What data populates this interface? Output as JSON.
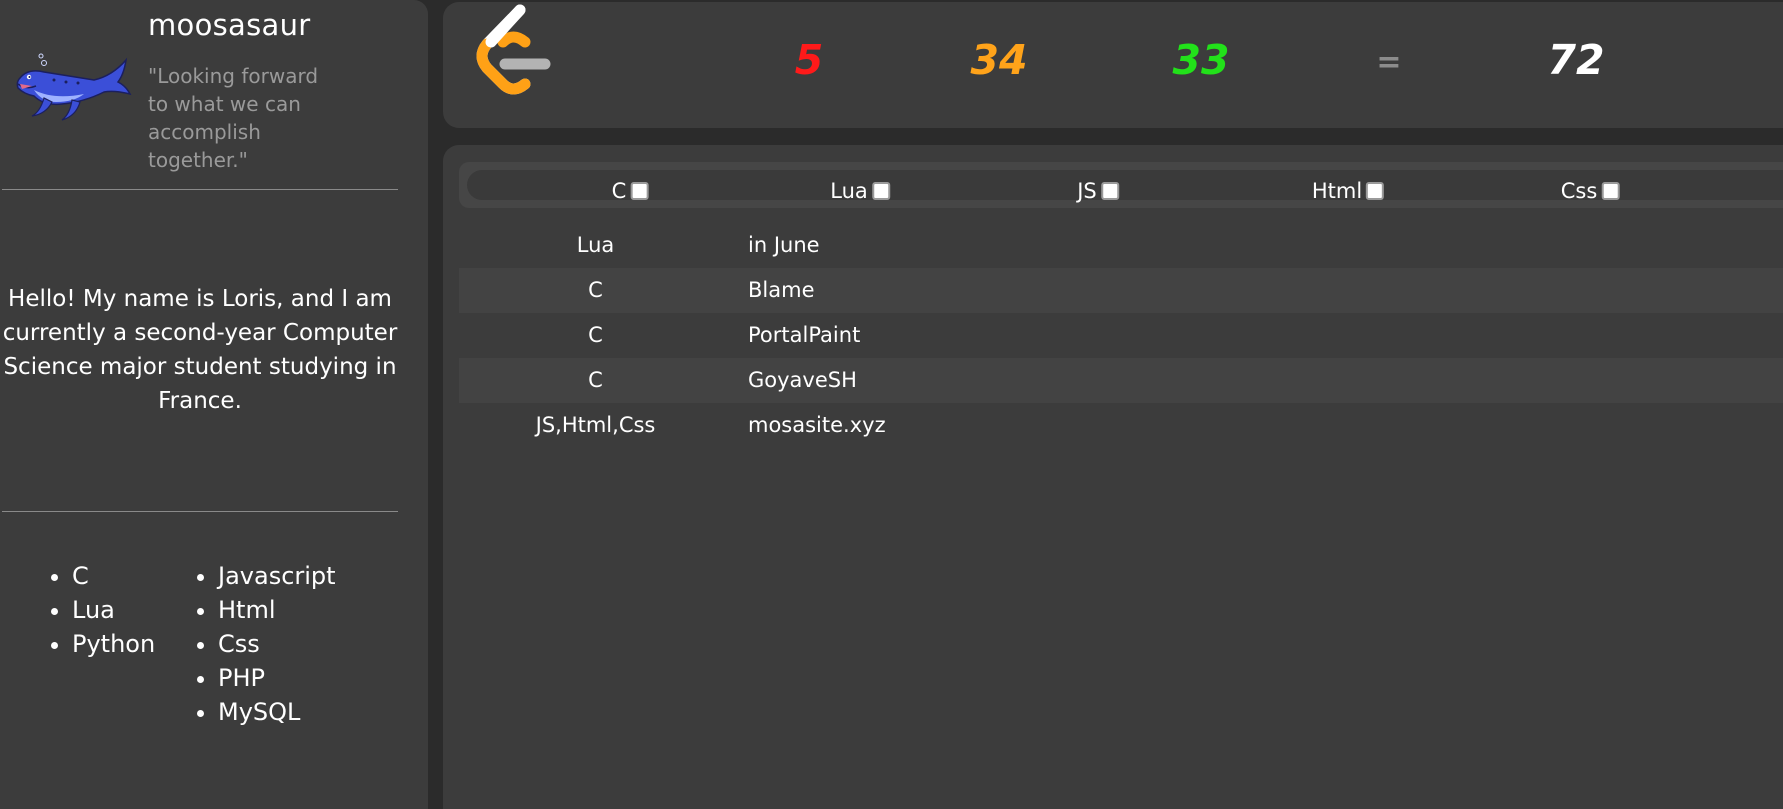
{
  "profile": {
    "username": "moosasaur",
    "quote": "\"Looking forward to what we can accomplish together.\"",
    "bio": "Hello! My name is Loris, and I am currently a second-year Computer Science major student studying in France.",
    "languages_col1": [
      "C",
      "Lua",
      "Python"
    ],
    "languages_col2": [
      "Javascript",
      "Html",
      "Css",
      "PHP",
      "MySQL"
    ]
  },
  "stats": {
    "easy": "5",
    "medium": "34",
    "hard": "33",
    "equals": "=",
    "total": "72",
    "colors": {
      "easy": "#ff1a1a",
      "medium": "#ffa31a",
      "hard": "#22e11a",
      "total": "#ffffff"
    }
  },
  "filters": [
    {
      "label": "C",
      "checked": false
    },
    {
      "label": "Lua",
      "checked": false
    },
    {
      "label": "JS",
      "checked": false
    },
    {
      "label": "Html",
      "checked": false
    },
    {
      "label": "Css",
      "checked": false
    }
  ],
  "projects": [
    {
      "lang": "Lua",
      "name": "in June"
    },
    {
      "lang": "C",
      "name": "Blame"
    },
    {
      "lang": "C",
      "name": "PortalPaint"
    },
    {
      "lang": "C",
      "name": "GoyaveSH"
    },
    {
      "lang": "JS,Html,Css",
      "name": "mosasite.xyz"
    }
  ],
  "icons": {
    "avatar": "mosasaur-avatar",
    "logo": "leetcode-logo-icon"
  }
}
